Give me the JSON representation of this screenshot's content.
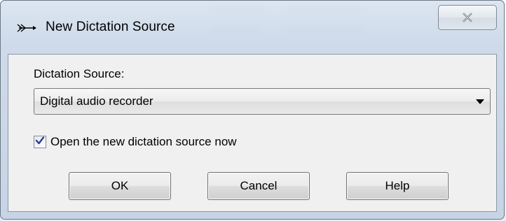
{
  "window": {
    "title": "New Dictation Source",
    "icon": "dictation-source-icon",
    "close_icon": "close-icon"
  },
  "form": {
    "source_label": "Dictation Source:",
    "source_value": "Digital audio recorder",
    "open_now_label": "Open the new dictation source now",
    "open_now_checked": true
  },
  "buttons": {
    "ok": "OK",
    "cancel": "Cancel",
    "help": "Help"
  },
  "colors": {
    "accent": "#3a6fbf",
    "frame": "#cbd8e8"
  }
}
